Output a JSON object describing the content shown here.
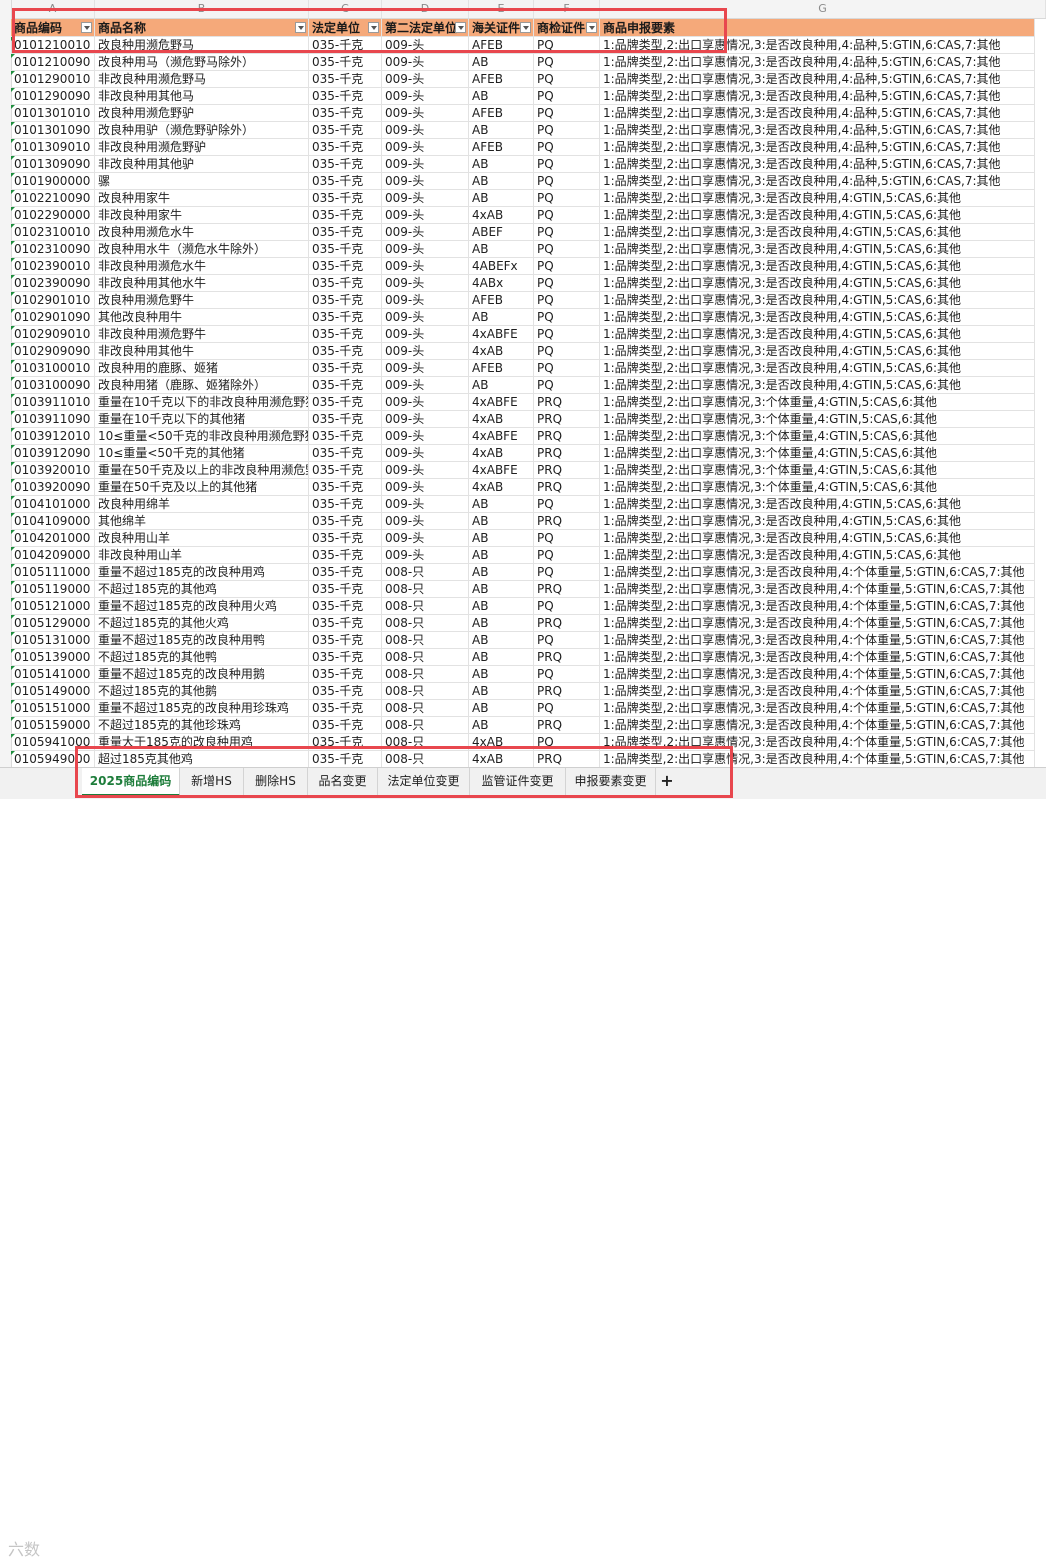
{
  "columns": [
    "A",
    "B",
    "C",
    "D",
    "E",
    "F",
    "G"
  ],
  "headers": [
    "商品编码",
    "商品名称",
    "法定单位",
    "第二法定单位",
    "海关证件",
    "商检证件",
    "商品申报要素"
  ],
  "rows": [
    [
      "0101210010",
      "改良种用濒危野马",
      "035-千克",
      "009-头",
      "AFEB",
      "PQ",
      "1:品牌类型,2:出口享惠情况,3:是否改良种用,4:品种,5:GTIN,6:CAS,7:其他"
    ],
    [
      "0101210090",
      "改良种用马（濒危野马除外）",
      "035-千克",
      "009-头",
      "AB",
      "PQ",
      "1:品牌类型,2:出口享惠情况,3:是否改良种用,4:品种,5:GTIN,6:CAS,7:其他"
    ],
    [
      "0101290010",
      "非改良种用濒危野马",
      "035-千克",
      "009-头",
      "AFEB",
      "PQ",
      "1:品牌类型,2:出口享惠情况,3:是否改良种用,4:品种,5:GTIN,6:CAS,7:其他"
    ],
    [
      "0101290090",
      "非改良种用其他马",
      "035-千克",
      "009-头",
      "AB",
      "PQ",
      "1:品牌类型,2:出口享惠情况,3:是否改良种用,4:品种,5:GTIN,6:CAS,7:其他"
    ],
    [
      "0101301010",
      "改良种用濒危野驴",
      "035-千克",
      "009-头",
      "AFEB",
      "PQ",
      "1:品牌类型,2:出口享惠情况,3:是否改良种用,4:品种,5:GTIN,6:CAS,7:其他"
    ],
    [
      "0101301090",
      "改良种用驴（濒危野驴除外）",
      "035-千克",
      "009-头",
      "AB",
      "PQ",
      "1:品牌类型,2:出口享惠情况,3:是否改良种用,4:品种,5:GTIN,6:CAS,7:其他"
    ],
    [
      "0101309010",
      "非改良种用濒危野驴",
      "035-千克",
      "009-头",
      "AFEB",
      "PQ",
      "1:品牌类型,2:出口享惠情况,3:是否改良种用,4:品种,5:GTIN,6:CAS,7:其他"
    ],
    [
      "0101309090",
      "非改良种用其他驴",
      "035-千克",
      "009-头",
      "AB",
      "PQ",
      "1:品牌类型,2:出口享惠情况,3:是否改良种用,4:品种,5:GTIN,6:CAS,7:其他"
    ],
    [
      "0101900000",
      "骡",
      "035-千克",
      "009-头",
      "AB",
      "PQ",
      "1:品牌类型,2:出口享惠情况,3:是否改良种用,4:品种,5:GTIN,6:CAS,7:其他"
    ],
    [
      "0102210090",
      "改良种用家牛",
      "035-千克",
      "009-头",
      "AB",
      "PQ",
      "1:品牌类型,2:出口享惠情况,3:是否改良种用,4:GTIN,5:CAS,6:其他"
    ],
    [
      "0102290000",
      "非改良种用家牛",
      "035-千克",
      "009-头",
      "4xAB",
      "PQ",
      "1:品牌类型,2:出口享惠情况,3:是否改良种用,4:GTIN,5:CAS,6:其他"
    ],
    [
      "0102310010",
      "改良种用濒危水牛",
      "035-千克",
      "009-头",
      "ABEF",
      "PQ",
      "1:品牌类型,2:出口享惠情况,3:是否改良种用,4:GTIN,5:CAS,6:其他"
    ],
    [
      "0102310090",
      "改良种用水牛（濒危水牛除外）",
      "035-千克",
      "009-头",
      "AB",
      "PQ",
      "1:品牌类型,2:出口享惠情况,3:是否改良种用,4:GTIN,5:CAS,6:其他"
    ],
    [
      "0102390010",
      "非改良种用濒危水牛",
      "035-千克",
      "009-头",
      "4ABEFx",
      "PQ",
      "1:品牌类型,2:出口享惠情况,3:是否改良种用,4:GTIN,5:CAS,6:其他"
    ],
    [
      "0102390090",
      "非改良种用其他水牛",
      "035-千克",
      "009-头",
      "4ABx",
      "PQ",
      "1:品牌类型,2:出口享惠情况,3:是否改良种用,4:GTIN,5:CAS,6:其他"
    ],
    [
      "0102901010",
      "改良种用濒危野牛",
      "035-千克",
      "009-头",
      "AFEB",
      "PQ",
      "1:品牌类型,2:出口享惠情况,3:是否改良种用,4:GTIN,5:CAS,6:其他"
    ],
    [
      "0102901090",
      "其他改良种用牛",
      "035-千克",
      "009-头",
      "AB",
      "PQ",
      "1:品牌类型,2:出口享惠情况,3:是否改良种用,4:GTIN,5:CAS,6:其他"
    ],
    [
      "0102909010",
      "非改良种用濒危野牛",
      "035-千克",
      "009-头",
      "4xABFE",
      "PQ",
      "1:品牌类型,2:出口享惠情况,3:是否改良种用,4:GTIN,5:CAS,6:其他"
    ],
    [
      "0102909090",
      "非改良种用其他牛",
      "035-千克",
      "009-头",
      "4xAB",
      "PQ",
      "1:品牌类型,2:出口享惠情况,3:是否改良种用,4:GTIN,5:CAS,6:其他"
    ],
    [
      "0103100010",
      "改良种用的鹿豚、姬猪",
      "035-千克",
      "009-头",
      "AFEB",
      "PQ",
      "1:品牌类型,2:出口享惠情况,3:是否改良种用,4:GTIN,5:CAS,6:其他"
    ],
    [
      "0103100090",
      "改良种用猪（鹿豚、姬猪除外）",
      "035-千克",
      "009-头",
      "AB",
      "PQ",
      "1:品牌类型,2:出口享惠情况,3:是否改良种用,4:GTIN,5:CAS,6:其他"
    ],
    [
      "0103911010",
      "重量在10千克以下的非改良种用濒危野猪",
      "035-千克",
      "009-头",
      "4xABFE",
      "PRQ",
      "1:品牌类型,2:出口享惠情况,3:个体重量,4:GTIN,5:CAS,6:其他"
    ],
    [
      "0103911090",
      "重量在10千克以下的其他猪",
      "035-千克",
      "009-头",
      "4xAB",
      "PRQ",
      "1:品牌类型,2:出口享惠情况,3:个体重量,4:GTIN,5:CAS,6:其他"
    ],
    [
      "0103912010",
      "10≤重量<50千克的非改良种用濒危野猪",
      "035-千克",
      "009-头",
      "4xABFE",
      "PRQ",
      "1:品牌类型,2:出口享惠情况,3:个体重量,4:GTIN,5:CAS,6:其他"
    ],
    [
      "0103912090",
      "10≤重量<50千克的其他猪",
      "035-千克",
      "009-头",
      "4xAB",
      "PRQ",
      "1:品牌类型,2:出口享惠情况,3:个体重量,4:GTIN,5:CAS,6:其他"
    ],
    [
      "0103920010",
      "重量在50千克及以上的非改良种用濒危野猪",
      "035-千克",
      "009-头",
      "4xABFE",
      "PRQ",
      "1:品牌类型,2:出口享惠情况,3:个体重量,4:GTIN,5:CAS,6:其他"
    ],
    [
      "0103920090",
      "重量在50千克及以上的其他猪",
      "035-千克",
      "009-头",
      "4xAB",
      "PRQ",
      "1:品牌类型,2:出口享惠情况,3:个体重量,4:GTIN,5:CAS,6:其他"
    ],
    [
      "0104101000",
      "改良种用绵羊",
      "035-千克",
      "009-头",
      "AB",
      "PQ",
      "1:品牌类型,2:出口享惠情况,3:是否改良种用,4:GTIN,5:CAS,6:其他"
    ],
    [
      "0104109000",
      "其他绵羊",
      "035-千克",
      "009-头",
      "AB",
      "PRQ",
      "1:品牌类型,2:出口享惠情况,3:是否改良种用,4:GTIN,5:CAS,6:其他"
    ],
    [
      "0104201000",
      "改良种用山羊",
      "035-千克",
      "009-头",
      "AB",
      "PQ",
      "1:品牌类型,2:出口享惠情况,3:是否改良种用,4:GTIN,5:CAS,6:其他"
    ],
    [
      "0104209000",
      "非改良种用山羊",
      "035-千克",
      "009-头",
      "AB",
      "PQ",
      "1:品牌类型,2:出口享惠情况,3:是否改良种用,4:GTIN,5:CAS,6:其他"
    ],
    [
      "0105111000",
      "重量不超过185克的改良种用鸡",
      "035-千克",
      "008-只",
      "AB",
      "PQ",
      "1:品牌类型,2:出口享惠情况,3:是否改良种用,4:个体重量,5:GTIN,6:CAS,7:其他"
    ],
    [
      "0105119000",
      "不超过185克的其他鸡",
      "035-千克",
      "008-只",
      "AB",
      "PRQ",
      "1:品牌类型,2:出口享惠情况,3:是否改良种用,4:个体重量,5:GTIN,6:CAS,7:其他"
    ],
    [
      "0105121000",
      "重量不超过185克的改良种用火鸡",
      "035-千克",
      "008-只",
      "AB",
      "PQ",
      "1:品牌类型,2:出口享惠情况,3:是否改良种用,4:个体重量,5:GTIN,6:CAS,7:其他"
    ],
    [
      "0105129000",
      "不超过185克的其他火鸡",
      "035-千克",
      "008-只",
      "AB",
      "PRQ",
      "1:品牌类型,2:出口享惠情况,3:是否改良种用,4:个体重量,5:GTIN,6:CAS,7:其他"
    ],
    [
      "0105131000",
      "重量不超过185克的改良种用鸭",
      "035-千克",
      "008-只",
      "AB",
      "PQ",
      "1:品牌类型,2:出口享惠情况,3:是否改良种用,4:个体重量,5:GTIN,6:CAS,7:其他"
    ],
    [
      "0105139000",
      "不超过185克的其他鸭",
      "035-千克",
      "008-只",
      "AB",
      "PRQ",
      "1:品牌类型,2:出口享惠情况,3:是否改良种用,4:个体重量,5:GTIN,6:CAS,7:其他"
    ],
    [
      "0105141000",
      "重量不超过185克的改良种用鹅",
      "035-千克",
      "008-只",
      "AB",
      "PQ",
      "1:品牌类型,2:出口享惠情况,3:是否改良种用,4:个体重量,5:GTIN,6:CAS,7:其他"
    ],
    [
      "0105149000",
      "不超过185克的其他鹅",
      "035-千克",
      "008-只",
      "AB",
      "PRQ",
      "1:品牌类型,2:出口享惠情况,3:是否改良种用,4:个体重量,5:GTIN,6:CAS,7:其他"
    ],
    [
      "0105151000",
      "重量不超过185克的改良种用珍珠鸡",
      "035-千克",
      "008-只",
      "AB",
      "PQ",
      "1:品牌类型,2:出口享惠情况,3:是否改良种用,4:个体重量,5:GTIN,6:CAS,7:其他"
    ],
    [
      "0105159000",
      "不超过185克的其他珍珠鸡",
      "035-千克",
      "008-只",
      "AB",
      "PRQ",
      "1:品牌类型,2:出口享惠情况,3:是否改良种用,4:个体重量,5:GTIN,6:CAS,7:其他"
    ],
    [
      "0105941000",
      "重量大于185克的改良种用鸡",
      "035-千克",
      "008-只",
      "4xAB",
      "PQ",
      "1:品牌类型,2:出口享惠情况,3:是否改良种用,4:个体重量,5:GTIN,6:CAS,7:其他"
    ],
    [
      "0105949000",
      "超过185克其他鸡",
      "035-千克",
      "008-只",
      "4xAB",
      "PRQ",
      "1:品牌类型,2:出口享惠情况,3:是否改良种用,4:个体重量,5:GTIN,6:CAS,7:其他"
    ]
  ],
  "tabs": [
    "2025商品编码",
    "新增HS",
    "删除HS",
    "品名变更",
    "法定单位变更",
    "监管证件变更",
    "申报要素变更"
  ],
  "add_tab": "+",
  "watermark": "六数",
  "colors": {
    "header_fill": "#f5a97a",
    "highlight": "#e8474e",
    "active_tab": "#1e7d3b"
  }
}
